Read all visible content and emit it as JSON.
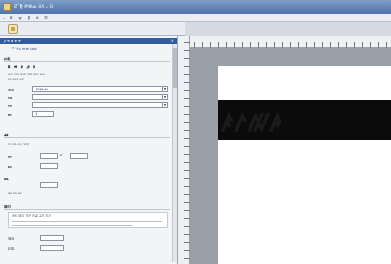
{
  "window": {
    "title": "Ƨ˜Ĳ̴ ꯒ֍ԃ ʋ̆ʎ ޙ ꢤ"
  },
  "menu": {
    "items": [
      "꜡",
      "ȣ",
      "ꝡ",
      "ꞵ",
      "ꝺ",
      "Ꝺ"
    ]
  },
  "panel": {
    "header": "ꭗ ꮃ ꮖ ꮘ ꮱ",
    "close": "×",
    "link": "ꭝꭞ ꭟꭠ ꭡꭢ ꭣꭤ",
    "section1": "ꭥꭦ",
    "bold_row": "ꭼ ꭽ ꭾ ꭿ ꮀ",
    "desc1": "ꮂꮃ ꮄꮅꮆ ꮇꮈꮉ ꮊꮋ ꮌꮍꮎ ꮏꮐꮑ",
    "desc2": "ꮒꮓ ꮔꮕꮖ ꮗꮘ",
    "row1_label": "ꮙꮚ",
    "row1_value": "ꮛꮜꮝꮞ ꮟꮠ",
    "row2_label": "ꮡꮢ",
    "row2_value": "",
    "row3_label": "ꮣꮤ",
    "row3_value": "",
    "row4_label": "ꮥꮦ",
    "row4_value": "1",
    "section2": "ꮧꮨ",
    "desc3": "ꮩꮪ ꮫꮬ ꮭꮮꮯ ꮰꮱꮲ",
    "spin1_label": "ꮳꮴ",
    "spin1_value": "",
    "spin1_unit": "ꮵ",
    "spin2_label": "ꮶꮷ",
    "spin2_value": "",
    "section3": "ꮸꮹ",
    "desc4": "ꮺꮻ ꮼꮽ ꮾꮿ",
    "section4": "ꯀꯁ",
    "desc5": "ꯂꯃ ꯄꯅ ꯆꯇ ꯈꯉ ꯊꯋ ꯌꯍ",
    "bottom1_label": "ꯎꯏ",
    "bottom1_value": "",
    "bottom2_label": "ꯐꯑ",
    "bottom2_value": ""
  },
  "canvas": {
    "banner_text": "ꤰꤱꤲꤳ"
  }
}
